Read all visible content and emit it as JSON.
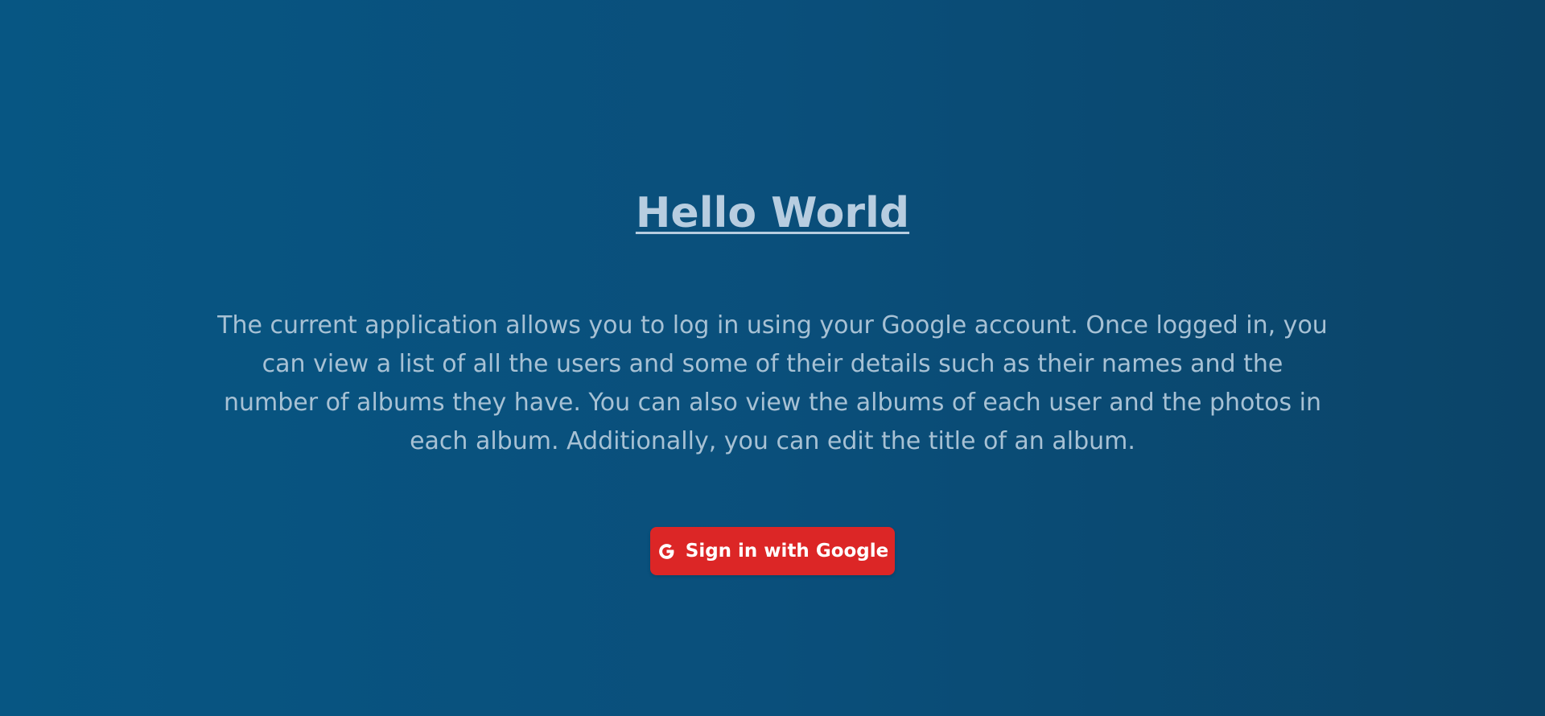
{
  "page": {
    "title": "Hello World",
    "description": "The current application allows you to log in using your Google account. Once logged in, you can view a list of all the users and some of their details such as their names and the number of albums they have. You can also view the albums of each user and the photos in each album. Additionally, you can edit the title of an album."
  },
  "signin": {
    "label": "Sign in with Google",
    "icon": "google-icon"
  },
  "colors": {
    "background_left": "#075683",
    "background_right": "#0b4468",
    "text": "#a7c1d4",
    "button": "#dc2626",
    "button_text": "#ffffff"
  }
}
